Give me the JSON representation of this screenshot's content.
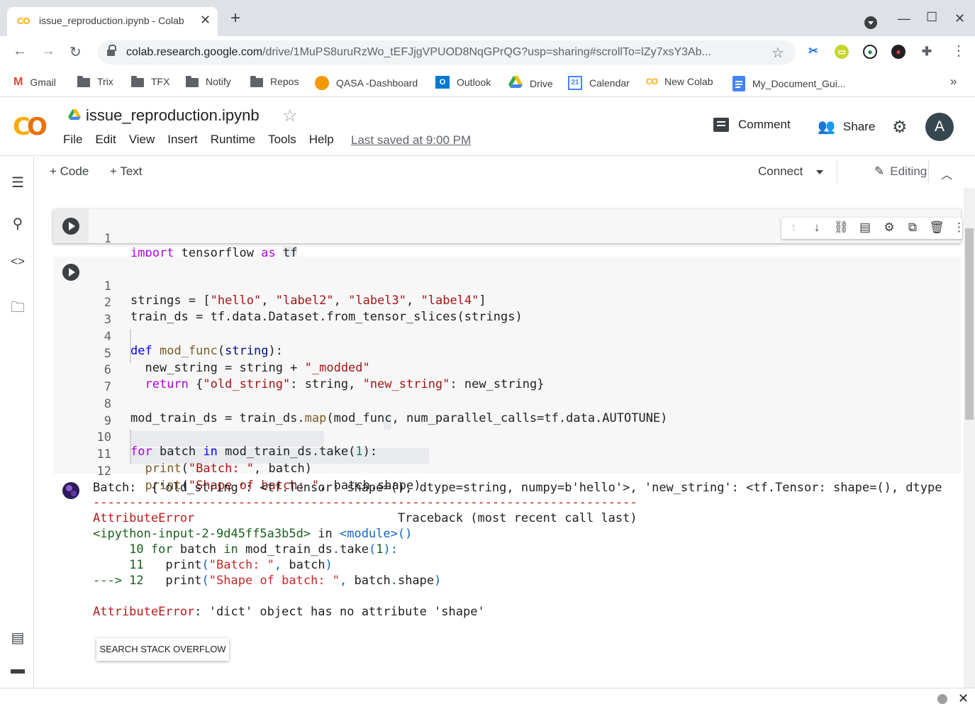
{
  "browser": {
    "tab_title": "issue_reproduction.ipynb - Colab",
    "tab_favicon": "CO",
    "new_tab_label": "+",
    "url_host": "colab.research.google.com",
    "url_path": "/drive/1MuPS8uruRzWo_tEFJjgVPUOD8NqGPrQG?usp=sharing#scrollTo=lZy7xsY3Ab..."
  },
  "bookmarks": [
    {
      "label": "Gmail",
      "icon": "gmail-icon"
    },
    {
      "label": "Trix",
      "icon": "folder-icon"
    },
    {
      "label": "TFX",
      "icon": "folder-icon"
    },
    {
      "label": "Notify",
      "icon": "folder-icon"
    },
    {
      "label": "Repos",
      "icon": "folder-icon"
    },
    {
      "label": "QASA -Dashboard",
      "icon": "qasa-icon"
    },
    {
      "label": "Outlook",
      "icon": "outlook-icon"
    },
    {
      "label": "Drive",
      "icon": "drive-icon"
    },
    {
      "label": "Calendar",
      "icon": "calendar-icon"
    },
    {
      "label": "New Colab",
      "icon": "colab-icon"
    },
    {
      "label": "My_Document_Gui...",
      "icon": "docs-icon"
    }
  ],
  "bookmarks_overflow": "»",
  "colab": {
    "logo": "CO",
    "notebook_title": "issue_reproduction.ipynb",
    "menu": [
      "File",
      "Edit",
      "View",
      "Insert",
      "Runtime",
      "Tools",
      "Help"
    ],
    "last_saved": "Last saved at 9:00 PM",
    "comment_label": "Comment",
    "share_label": "Share",
    "avatar_letter": "A",
    "add_code_label": "+ Code",
    "add_text_label": "+ Text",
    "connect_label": "Connect",
    "editing_label": "Editing"
  },
  "cell1": {
    "line_numbers": [
      "1"
    ],
    "code": "import tensorflow as tf"
  },
  "cell2": {
    "line_numbers": [
      "1",
      "2",
      "3",
      "4",
      "5",
      "6",
      "7",
      "8",
      "9",
      "10",
      "11",
      "12"
    ],
    "lines": [
      "strings = [\"hello\", \"label2\", \"label3\", \"label4\"]",
      "train_ds = tf.data.Dataset.from_tensor_slices(strings)",
      "",
      "def mod_func(string):",
      "  new_string = string + \"_modded\"",
      "  return {\"old_string\": string, \"new_string\": new_string}",
      "",
      "mod_train_ds = train_ds.map(mod_func, num_parallel_calls=tf.data.AUTOTUNE)",
      "",
      "for batch in mod_train_ds.take(1):",
      "  print(\"Batch: \", batch)",
      "  print(\"Shape of batch: \", batch.shape)"
    ]
  },
  "output": {
    "lines": [
      "Batch:  {'old_string': <tf.Tensor: shape=(), dtype=string, numpy=b'hello'>, 'new_string': <tf.Tensor: shape=(), dtype",
      "---------------------------------------------------------------------------",
      "AttributeError                            Traceback (most recent call last)",
      "<ipython-input-2-9d45ff5a3b5d> in <module>()",
      "     10 for batch in mod_train_ds.take(1):",
      "     11   print(\"Batch: \", batch)",
      "---> 12   print(\"Shape of batch: \", batch.shape)",
      "",
      "AttributeError: 'dict' object has no attribute 'shape'"
    ],
    "search_button": "SEARCH STACK OVERFLOW"
  }
}
